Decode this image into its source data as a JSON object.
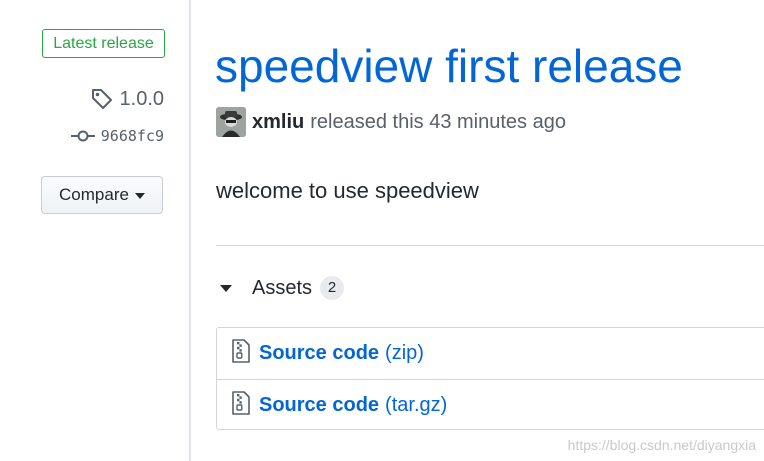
{
  "sidebar": {
    "badge": "Latest release",
    "tag": "1.0.0",
    "commit": "9668fc9",
    "compare_label": "Compare"
  },
  "release": {
    "title": "speedview first release",
    "author": "xmliu",
    "released_text": "released this 43 minutes ago",
    "body": "welcome to use speedview"
  },
  "assets": {
    "heading": "Assets",
    "count": "2",
    "items": [
      {
        "name": "Source code",
        "ext": "(zip)",
        "icon": "file-zip-icon"
      },
      {
        "name": "Source code",
        "ext": "(tar.gz)",
        "icon": "file-zip-icon"
      }
    ]
  },
  "watermark": "https://blog.csdn.net/diyangxia",
  "colors": {
    "link": "#0366d6",
    "badge_green": "#28a745",
    "muted": "#586069",
    "border": "#d1d5da"
  }
}
